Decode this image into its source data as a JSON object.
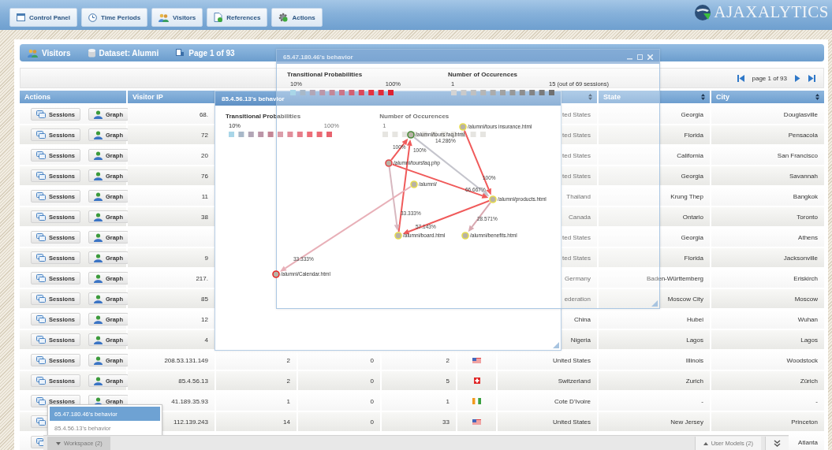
{
  "tabs": [
    {
      "label": "Control Panel",
      "kind": "panel"
    },
    {
      "label": "Time Periods",
      "kind": "clock"
    },
    {
      "label": "Visitors",
      "kind": "people"
    },
    {
      "label": "References",
      "kind": "document"
    },
    {
      "label": "Actions",
      "kind": "gear"
    }
  ],
  "logo": "AJAXALYTICS",
  "panel": {
    "title": "Visitors",
    "dataset": "Dataset: Alumni",
    "page": "Page 1 of 93"
  },
  "pager": {
    "label": "page 1 of 93"
  },
  "table": {
    "columns": [
      {
        "label": "Actions",
        "sort": false
      },
      {
        "label": "Visitor IP",
        "sort": false
      },
      {
        "sort": true
      },
      {
        "label": "State",
        "sort": true
      },
      {
        "label": "City",
        "sort": true
      }
    ],
    "rows": [
      {
        "buttons": [
          {
            "kind": "sessions",
            "label": "Sessions"
          },
          {
            "kind": "graph",
            "label": "Graph"
          }
        ],
        "ip": "68.",
        "country": "ted States",
        "state": "Georgia",
        "city": "Douglasville"
      },
      {
        "buttons": [
          {
            "kind": "sessions",
            "label": "Sessions"
          },
          {
            "kind": "graph",
            "label": "Graph"
          }
        ],
        "ip": "72",
        "country": "ted States",
        "state": "Florida",
        "city": "Pensacola"
      },
      {
        "buttons": [
          {
            "kind": "sessions",
            "label": "Sessions"
          },
          {
            "kind": "graph",
            "label": "Graph"
          }
        ],
        "ip": "20",
        "country": "ted States",
        "state": "California",
        "city": "San Francisco"
      },
      {
        "buttons": [
          {
            "kind": "sessions",
            "label": "Sessions"
          },
          {
            "kind": "graph",
            "label": "Graph"
          }
        ],
        "ip": "76",
        "country": "ted States",
        "state": "Georgia",
        "city": "Savannah"
      },
      {
        "buttons": [
          {
            "kind": "sessions",
            "label": "Sessions"
          },
          {
            "kind": "graph",
            "label": "Graph"
          }
        ],
        "ip": "11",
        "country": "Thailand",
        "state": "Krung Thep",
        "city": "Bangkok"
      },
      {
        "buttons": [
          {
            "kind": "sessions",
            "label": "Sessions"
          },
          {
            "kind": "graph",
            "label": "Graph"
          }
        ],
        "ip": "38",
        "country": "Canada",
        "state": "Ontario",
        "city": "Toronto"
      },
      {
        "buttons": [
          {
            "kind": "sessions",
            "label": "Sessions"
          },
          {
            "kind": "graph",
            "label": "Graph"
          }
        ],
        "country": "ted States",
        "state": "Georgia",
        "city": "Athens"
      },
      {
        "buttons": [
          {
            "kind": "sessions",
            "label": "Sessions"
          },
          {
            "kind": "graph",
            "label": "Graph"
          }
        ],
        "ip": "9",
        "country": "ted States",
        "state": "Florida",
        "city": "Jacksonville"
      },
      {
        "buttons": [
          {
            "kind": "sessions",
            "label": "Sessions"
          },
          {
            "kind": "graph",
            "label": "Graph"
          }
        ],
        "ip": "217.",
        "country": "Germany",
        "state": "Baden-Württemberg",
        "city": "Eriskirch"
      },
      {
        "buttons": [
          {
            "kind": "sessions",
            "label": "Sessions"
          },
          {
            "kind": "graph",
            "label": "Graph"
          }
        ],
        "ip": "85",
        "country": "ederation",
        "state": "Moscow City",
        "city": "Moscow"
      },
      {
        "buttons": [
          {
            "kind": "sessions",
            "label": "Sessions"
          },
          {
            "kind": "graph",
            "label": "Graph"
          }
        ],
        "ip": "12",
        "country": "China",
        "state": "Hubei",
        "city": "Wuhan"
      },
      {
        "buttons": [
          {
            "kind": "sessions",
            "label": "Sessions"
          },
          {
            "kind": "graph",
            "label": "Graph"
          }
        ],
        "ip": "4",
        "country": "Nigeria",
        "state": "Lagos",
        "city": "Lagos"
      },
      {
        "buttons": [
          {
            "kind": "sessions",
            "label": "Sessions"
          },
          {
            "kind": "graph",
            "label": "Graph"
          }
        ],
        "ip": "208.53.131.149",
        "column_3": "2",
        "column_4": "0",
        "column_5": "2",
        "flag": {
          "kind": "us"
        },
        "country": "United States",
        "state": "Illinois",
        "city": "Woodstock"
      },
      {
        "buttons": [
          {
            "kind": "sessions",
            "label": "Sessions"
          },
          {
            "kind": "graph",
            "label": "Graph"
          }
        ],
        "ip": "85.4.56.13",
        "column_3": "2",
        "column_4": "0",
        "column_5": "5",
        "flag": {
          "kind": "ch"
        },
        "country": "Switzerland",
        "state": "Zurich",
        "city": "Zürich"
      },
      {
        "buttons": [
          {
            "kind": "sessions",
            "label": "Sessions"
          },
          {
            "kind": "graph",
            "label": "Graph"
          }
        ],
        "ip": "41.189.35.93",
        "column_3": "1",
        "column_4": "0",
        "column_5": "1",
        "flag": {
          "kind": "ci"
        },
        "country": "Cote D'Ivoire",
        "state": "-",
        "city": "-"
      },
      {
        "buttons": [
          {
            "kind": "sessions"
          }
        ],
        "ip": "112.139.243",
        "column_3": "14",
        "column_4": "0",
        "column_5": "33",
        "flag": {
          "kind": "us"
        },
        "country": "United States",
        "state": "New Jersey",
        "city": "Princeton"
      },
      {
        "buttons": [
          {
            "kind": "sessions"
          }
        ],
        "city": "Atlanta"
      }
    ]
  },
  "windows": [
    {
      "title": "85.4.56.13's behavior",
      "legend": {
        "transitional_title": "Transitional Probabilities",
        "transitional_min": "10%",
        "transitional_max": "100%",
        "occurrences_title": "Number of Occurences",
        "occurrences_min": "1"
      },
      "graph": {
        "nodes": [
          {
            "label": "/alumni/tours faq.html",
            "color": "#4a8a3a"
          },
          {
            "label": "/alumni/tours insurance.html",
            "color": "#e6dc50"
          },
          {
            "label": "/alumni/toursfaq.php",
            "color": "#e04848"
          },
          {
            "label": "/alumni/",
            "color": "#e6dc50"
          },
          {
            "label": "/alumni/products.html",
            "color": "#e6dc50"
          },
          {
            "label": "/alumni/board.html",
            "color": "#e6dc50"
          },
          {
            "label": "/alumni/benefits.html",
            "color": "#e6dc50"
          },
          {
            "label": "/alumni/Calendar.html",
            "color": "#e82828"
          }
        ],
        "edges": [
          {
            "label": "100%",
            "color": "#f05a5a"
          },
          {
            "label": "100%",
            "color": "#f05a5a"
          },
          {
            "label": "14.286%",
            "color": "#c4c4cc"
          },
          {
            "label": "100%",
            "color": "#f05a5a"
          },
          {
            "label": "66.667%",
            "color": "#f05a5a"
          },
          {
            "label": "57.143%",
            "color": "#f05a5a"
          },
          {
            "label": "28.571%",
            "color": "#d8a8b0"
          },
          {
            "label": "33.333%",
            "color": "#d8b8c0"
          },
          {
            "label": "33.333%",
            "color": "#e8b0b8"
          }
        ]
      }
    },
    {
      "title": "65.47.180.46's behavior",
      "legend": {
        "transitional_title": "Transitional Probabilities",
        "transitional_min": "10%",
        "transitional_max": "100%",
        "occurrences_title": "Number of Occurences",
        "occurrences_min": "1",
        "occurrences_max": "15 (out of 69 sessions)"
      }
    }
  ],
  "workspace_menu": {
    "items": [
      {
        "label": "65.47.180.46's behavior",
        "selected": true
      },
      {
        "label": "85.4.56.13's behavior",
        "selected": false
      }
    ]
  },
  "bottom_bar": {
    "workspace": "Workspace (2)",
    "user_models": "User Models (2)"
  }
}
